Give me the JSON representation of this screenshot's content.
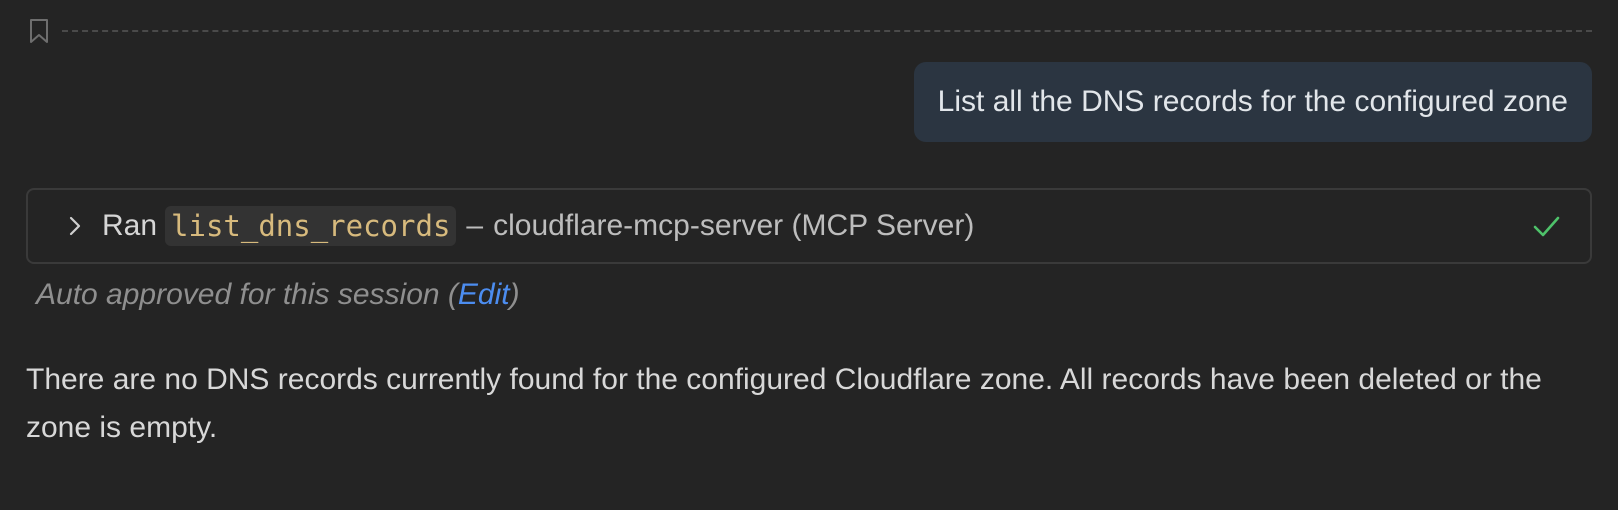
{
  "user_message": "List all the DNS records for the configured zone",
  "tool_call": {
    "prefix": "Ran",
    "tool_name": "list_dns_records",
    "separator": "–",
    "server": "cloudflare-mcp-server (MCP Server)",
    "status_icon": "checkmark-icon",
    "status_color": "#4ec26a"
  },
  "approval": {
    "text": "Auto approved for this session (",
    "edit_label": "Edit",
    "close": ")"
  },
  "response": "There are no DNS records currently found for the configured Cloudflare zone. All records have been deleted or the zone is empty.",
  "colors": {
    "background": "#242424",
    "user_bubble": "#2b3541",
    "link": "#4c8df0",
    "code_text": "#d7ba7d"
  }
}
